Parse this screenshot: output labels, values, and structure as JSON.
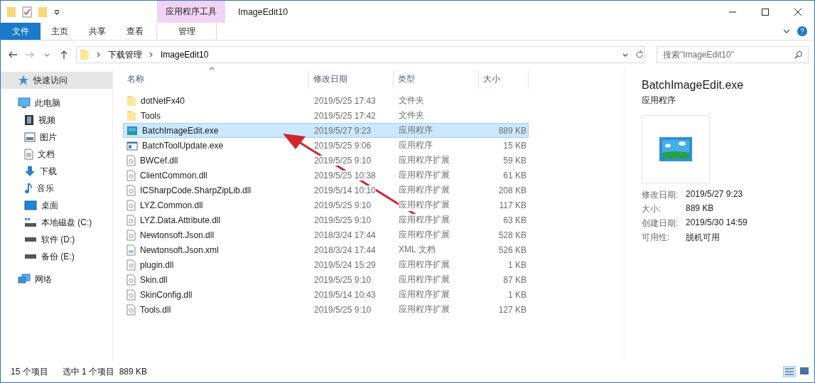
{
  "title_bar": {
    "context_group": "应用程序工具",
    "title": "ImageEdit10"
  },
  "ribbon": {
    "tabs": [
      {
        "label": "文件",
        "kind": "file"
      },
      {
        "label": "主页",
        "kind": "normal"
      },
      {
        "label": "共享",
        "kind": "normal"
      },
      {
        "label": "查看",
        "kind": "normal"
      },
      {
        "label": "管理",
        "kind": "contextual"
      }
    ]
  },
  "address_bar": {
    "path": [
      "下载管理",
      "ImageEdit10"
    ],
    "search": {
      "placeholder": "搜索\"ImageEdit10\""
    }
  },
  "sidebar": {
    "items": [
      {
        "label": "快速访问",
        "kind": "star",
        "selected": true
      },
      {
        "label": "此电脑",
        "kind": "pc",
        "selected": false,
        "children": [
          {
            "label": "视频",
            "kind": "video",
            "selected": false
          },
          {
            "label": "图片",
            "kind": "pictures",
            "selected": false
          },
          {
            "label": "文档",
            "kind": "document",
            "selected": false
          },
          {
            "label": "下载",
            "kind": "download",
            "selected": false
          },
          {
            "label": "音乐",
            "kind": "music",
            "selected": false
          },
          {
            "label": "桌面",
            "kind": "desktop",
            "selected": false
          },
          {
            "label": "本地磁盘 (C:)",
            "kind": "system",
            "selected": false
          },
          {
            "label": "软件 (D:)",
            "kind": "drive",
            "selected": false
          },
          {
            "label": "备份 (E:)",
            "kind": "drive",
            "selected": false
          }
        ]
      },
      {
        "label": "网络",
        "kind": "network",
        "selected": false
      }
    ]
  },
  "file_list": {
    "columns": [
      {
        "label": "名称",
        "sorted": true
      },
      {
        "label": "修改日期"
      },
      {
        "label": "类型"
      },
      {
        "label": "大小"
      }
    ],
    "rows": [
      {
        "name": "dotNetFx40",
        "date": "2019/5/25 17:43",
        "type": "文件夹",
        "kind": "folder",
        "selected": false
      },
      {
        "name": "Tools",
        "date": "2019/5/25 17:42",
        "type": "文件夹",
        "kind": "folder",
        "selected": false
      },
      {
        "name": "BatchImageEdit.exe",
        "date": "2019/5/27 9:23",
        "type": "应用程序",
        "size": "889 KB",
        "kind": "app",
        "selected": true
      },
      {
        "name": "BatchToolUpdate.exe",
        "date": "2019/5/25 9:06",
        "type": "应用程序",
        "size": "15 KB",
        "kind": "window",
        "selected": false
      },
      {
        "name": "BWCef.dll",
        "date": "2019/5/25 9:10",
        "type": "应用程序扩展",
        "size": "59 KB",
        "kind": "dll",
        "selected": false
      },
      {
        "name": "ClientCommon.dll",
        "date": "2019/5/25 10:38",
        "type": "应用程序扩展",
        "size": "61 KB",
        "kind": "dll",
        "selected": false
      },
      {
        "name": "ICSharpCode.SharpZipLib.dll",
        "date": "2019/5/14 10:10",
        "type": "应用程序扩展",
        "size": "208 KB",
        "kind": "dll",
        "selected": false
      },
      {
        "name": "LYZ.Common.dll",
        "date": "2019/5/25 9:10",
        "type": "应用程序扩展",
        "size": "117 KB",
        "kind": "dll",
        "selected": false
      },
      {
        "name": "LYZ.Data.Attribute.dll",
        "date": "2019/5/25 9:10",
        "type": "应用程序扩展",
        "size": "63 KB",
        "kind": "dll",
        "selected": false
      },
      {
        "name": "Newtonsoft.Json.dll",
        "date": "2018/3/24 17:44",
        "type": "应用程序扩展",
        "size": "528 KB",
        "kind": "dll",
        "selected": false
      },
      {
        "name": "Newtonsoft.Json.xml",
        "date": "2018/3/24 17:44",
        "type": "XML 文档",
        "size": "526 KB",
        "kind": "xml",
        "selected": false
      },
      {
        "name": "plugin.dll",
        "date": "2019/5/24 15:29",
        "type": "应用程序扩展",
        "size": "1 KB",
        "kind": "dll",
        "selected": false
      },
      {
        "name": "Skin.dll",
        "date": "2019/5/25 9:10",
        "type": "应用程序扩展",
        "size": "87 KB",
        "kind": "dll",
        "selected": false
      },
      {
        "name": "SkinConfig.dll",
        "date": "2019/5/14 10:43",
        "type": "应用程序扩展",
        "size": "1 KB",
        "kind": "dll",
        "selected": false
      },
      {
        "name": "Tools.dll",
        "date": "2019/5/25 9:10",
        "type": "应用程序扩展",
        "size": "127 KB",
        "kind": "dll",
        "selected": false
      }
    ]
  },
  "details_pane": {
    "title": "BatchImageEdit.exe",
    "type": "应用程序",
    "properties": [
      {
        "label": "修改日期:",
        "value": "2019/5/27 9:23"
      },
      {
        "label": "大小:",
        "value": "889 KB"
      },
      {
        "label": "创建日期:",
        "value": "2019/5/30 14:59"
      },
      {
        "label": "可用性:",
        "value": "脱机可用"
      }
    ]
  },
  "status_bar": {
    "count": "15 个项目",
    "selection": "选中 1 个项目  889 KB"
  }
}
